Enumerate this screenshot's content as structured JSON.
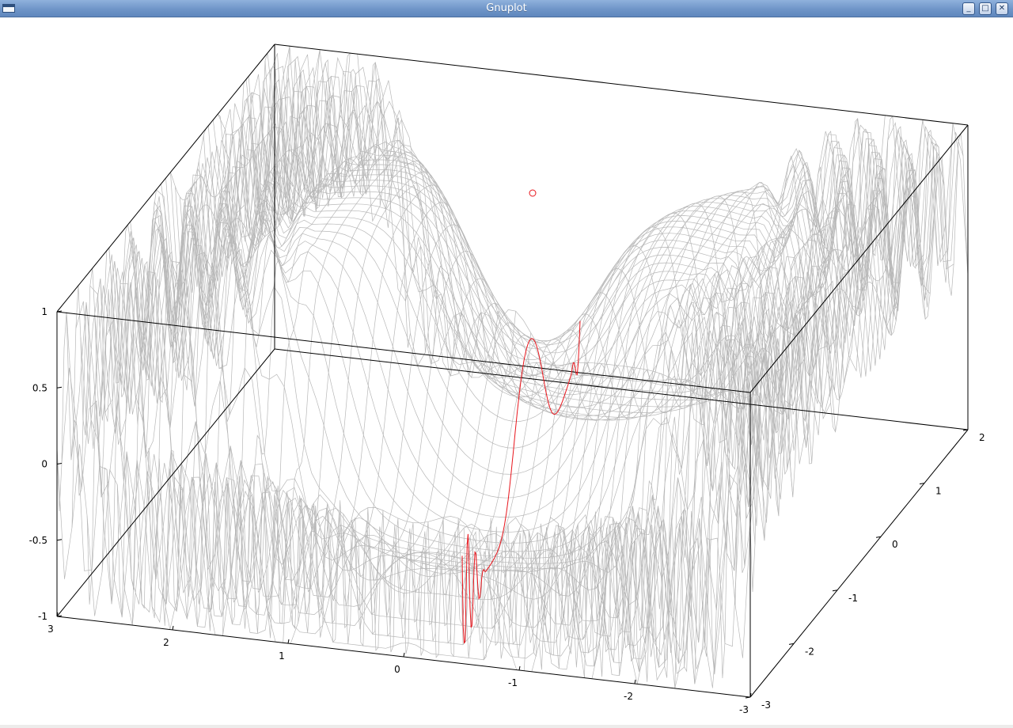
{
  "window": {
    "title": "Gnuplot",
    "menu_icon": "window-menu-icon",
    "buttons": {
      "minimize": "_",
      "maximize": "□",
      "close": "✕"
    }
  },
  "colors": {
    "background": "#edeceb",
    "plot_bg": "#ffffff",
    "surface": "#b8b8b8",
    "curve": "#e8141b",
    "axis": "#000000"
  },
  "chart_data": {
    "type": "surface",
    "zlim": [
      -1,
      1
    ],
    "xlim": [
      -3,
      3
    ],
    "ylim": [
      -3,
      2
    ],
    "z_ticks": [
      "1",
      "0.5",
      "0",
      "-0.5",
      "-1"
    ],
    "x_ticks": [
      "3",
      "2",
      "1",
      "0",
      "-1",
      "-2",
      "-3"
    ],
    "y_ticks": [
      "2",
      "1",
      "0",
      "-1",
      "-2",
      "-3"
    ],
    "grid": false,
    "series": [
      {
        "kind": "wireframe-surface"
      },
      {
        "kind": "curve"
      },
      {
        "kind": "point-marker",
        "marker": "circle"
      }
    ]
  }
}
